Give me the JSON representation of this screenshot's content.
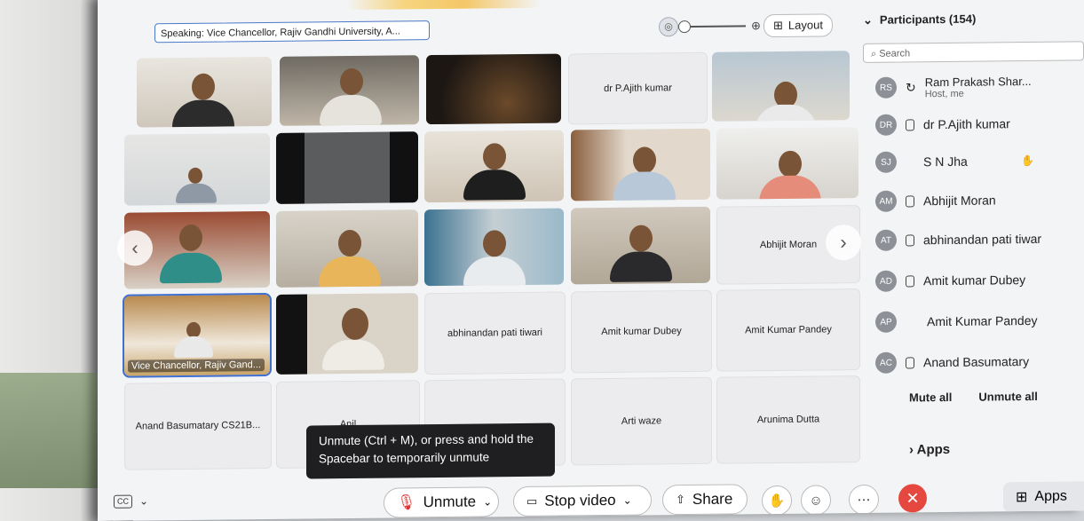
{
  "speaking_label": "Speaking: Vice Chancellor, Rajiv Gandhi University, A...",
  "layout_label": "Layout",
  "zoom_icon": "magnifier-icon",
  "tiles": [
    {
      "name": "",
      "type": "video"
    },
    {
      "name": "",
      "type": "video"
    },
    {
      "name": "",
      "type": "video"
    },
    {
      "name": "dr P.Ajith kumar",
      "type": "empty"
    },
    {
      "name": "",
      "type": "video"
    },
    {
      "name": "",
      "type": "video"
    },
    {
      "name": "",
      "type": "video"
    },
    {
      "name": "",
      "type": "video"
    },
    {
      "name": "",
      "type": "video"
    },
    {
      "name": "",
      "type": "video"
    },
    {
      "name": "",
      "type": "video"
    },
    {
      "name": "",
      "type": "video"
    },
    {
      "name": "",
      "type": "video"
    },
    {
      "name": "",
      "type": "video"
    },
    {
      "name": "Abhijit Moran",
      "type": "empty"
    },
    {
      "name": "Vice Chancellor, Rajiv Gand...",
      "type": "video"
    },
    {
      "name": "",
      "type": "video"
    },
    {
      "name": "abhinandan pati tiwari",
      "type": "empty"
    },
    {
      "name": "Amit kumar Dubey",
      "type": "empty"
    },
    {
      "name": "Amit Kumar Pandey",
      "type": "empty"
    },
    {
      "name": "Anand Basumatary CS21B...",
      "type": "empty"
    },
    {
      "name": "Anil",
      "type": "empty"
    },
    {
      "name": "",
      "type": "empty"
    },
    {
      "name": "Arti waze",
      "type": "empty"
    },
    {
      "name": "Arunima Dutta",
      "type": "empty"
    }
  ],
  "tooltip": "Unmute (Ctrl + M), or press and hold the Spacebar to temporarily unmute",
  "bottom": {
    "cc": "CC",
    "unmute": "Unmute",
    "stop_video": "Stop video",
    "share": "Share",
    "apps": "Apps"
  },
  "participants": {
    "title": "Participants (154)",
    "search_placeholder": "Search",
    "list": [
      {
        "initials": "RS",
        "name": "Ram Prakash Shar...",
        "sub": "Host, me"
      },
      {
        "initials": "DR",
        "name": "dr P.Ajith kumar",
        "sub": ""
      },
      {
        "initials": "SJ",
        "name": "S N Jha",
        "sub": ""
      },
      {
        "initials": "AM",
        "name": "Abhijit Moran",
        "sub": ""
      },
      {
        "initials": "AT",
        "name": "abhinandan pati tiwar",
        "sub": ""
      },
      {
        "initials": "AD",
        "name": "Amit kumar Dubey",
        "sub": ""
      },
      {
        "initials": "AP",
        "name": "Amit Kumar Pandey",
        "sub": ""
      },
      {
        "initials": "AC",
        "name": "Anand Basumatary",
        "sub": ""
      }
    ],
    "mute_all": "Mute all",
    "unmute_all": "Unmute all",
    "apps": "Apps"
  }
}
